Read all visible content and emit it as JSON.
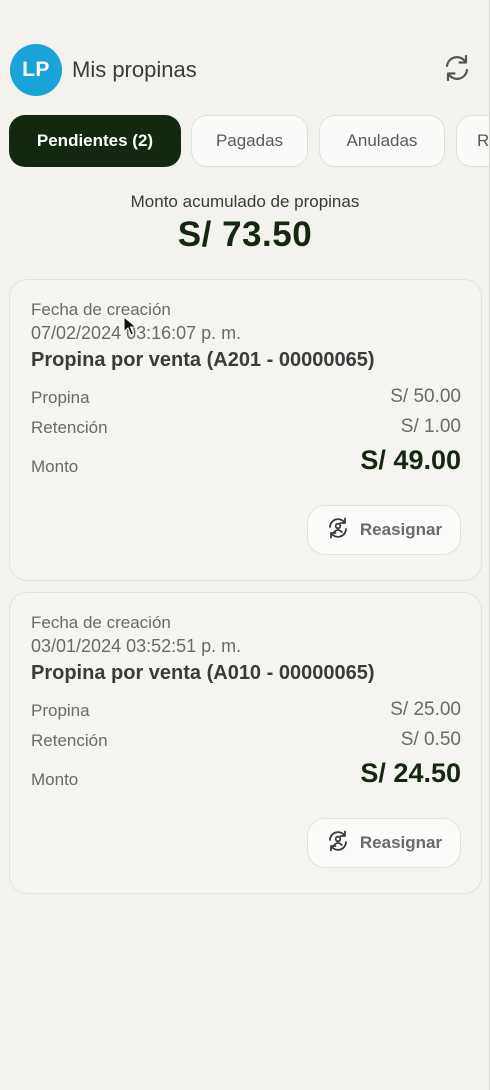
{
  "header": {
    "avatar_initials": "LP",
    "title": "Mis propinas",
    "refresh_icon": "refresh-icon"
  },
  "tabs": [
    {
      "label": "Pendientes (2)",
      "active": true
    },
    {
      "label": "Pagadas",
      "active": false
    },
    {
      "label": "Anuladas",
      "active": false
    },
    {
      "label": "R",
      "active": false
    }
  ],
  "summary": {
    "label": "Monto acumulado de propinas",
    "amount": "S/ 73.50"
  },
  "tips": [
    {
      "created_label": "Fecha de creación",
      "created_date": "07/02/2024 03:16:07 p. m.",
      "title": "Propina por venta (A201 - 00000065)",
      "propina_label": "Propina",
      "propina_value": "S/ 50.00",
      "retencion_label": "Retención",
      "retencion_value": "S/ 1.00",
      "monto_label": "Monto",
      "monto_value": "S/ 49.00",
      "reassign_label": "Reasignar"
    },
    {
      "created_label": "Fecha de creación",
      "created_date": "03/01/2024 03:52:51 p. m.",
      "title": "Propina por venta (A010 - 00000065)",
      "propina_label": "Propina",
      "propina_value": "S/ 25.00",
      "retencion_label": "Retención",
      "retencion_value": "S/ 0.50",
      "monto_label": "Monto",
      "monto_value": "S/ 24.50",
      "reassign_label": "Reasignar"
    }
  ],
  "colors": {
    "accent_dark": "#13280f",
    "avatar_bg": "#1aa3d6",
    "background": "#f3f2ef"
  }
}
